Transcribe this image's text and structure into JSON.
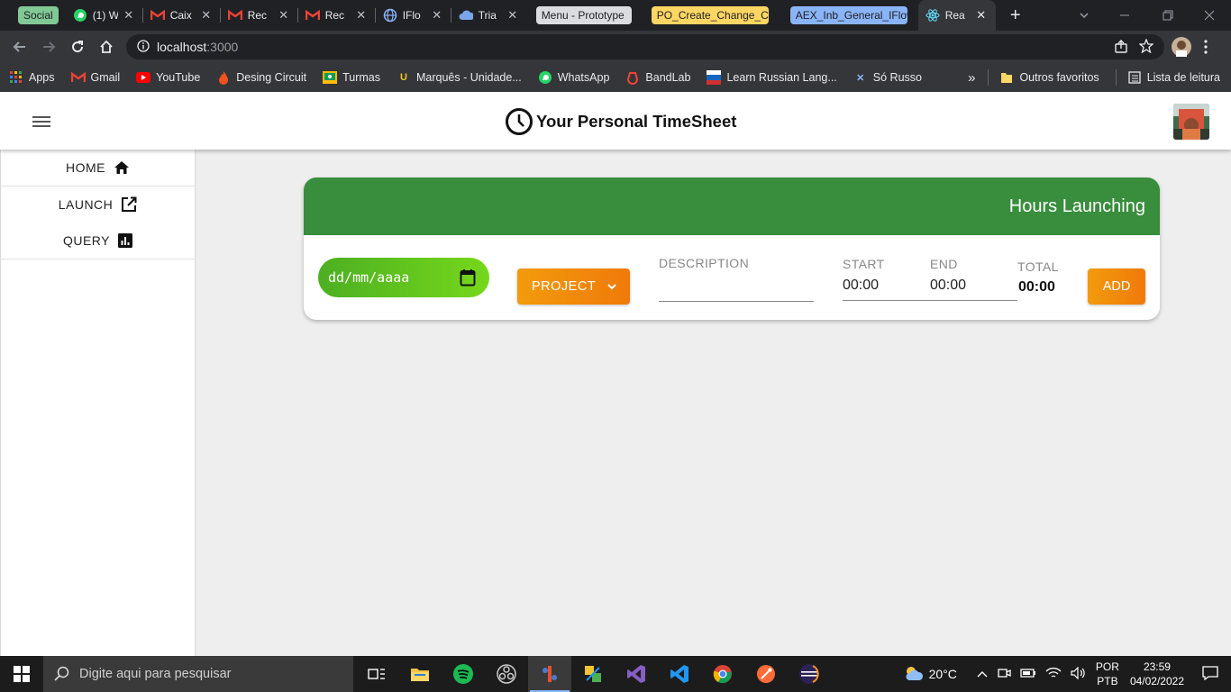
{
  "browser": {
    "tabs": [
      {
        "type": "group",
        "label": "Social",
        "color": "#81c995"
      },
      {
        "type": "tab",
        "title": "(1) W",
        "icon": "whatsapp-icon"
      },
      {
        "type": "tab",
        "title": "Caix",
        "icon": "gmail-icon"
      },
      {
        "type": "tab",
        "title": "Rec",
        "icon": "gmail-icon"
      },
      {
        "type": "tab",
        "title": "Rec",
        "icon": "gmail-icon"
      },
      {
        "type": "tab",
        "title": "IFlo",
        "icon": "globe-icon"
      },
      {
        "type": "tab",
        "title": "Tria",
        "icon": "cloud-icon"
      },
      {
        "type": "group",
        "label": "Menu - Prototype",
        "color": "#dadce0"
      },
      {
        "type": "group",
        "label": "PO_Create_Change_Ca",
        "color": "#fdd663"
      },
      {
        "type": "group",
        "label": "AEX_Inb_General_IFlow",
        "color": "#8ab4f8"
      },
      {
        "type": "tab",
        "title": "Rea",
        "icon": "react-icon",
        "active": true
      }
    ],
    "url_host": "localhost",
    "url_port": ":3000",
    "bookmarks": [
      {
        "label": "Apps",
        "icon": "apps-grid-icon"
      },
      {
        "label": "Gmail",
        "icon": "gmail-icon"
      },
      {
        "label": "YouTube",
        "icon": "youtube-icon"
      },
      {
        "label": "Desing Circuit",
        "icon": "flame-icon"
      },
      {
        "label": "Turmas",
        "icon": "classroom-icon"
      },
      {
        "label": "Marquês - Unidade...",
        "icon": "marques-icon"
      },
      {
        "label": "WhatsApp",
        "icon": "whatsapp-icon"
      },
      {
        "label": "BandLab",
        "icon": "bandlab-icon"
      },
      {
        "label": "Learn Russian Lang...",
        "icon": "flag-icon"
      },
      {
        "label": "Só Russo",
        "icon": "sorusso-icon"
      }
    ],
    "bookmarks_more": "»",
    "other_bookmarks": "Outros favoritos",
    "reading_list": "Lista de leitura"
  },
  "app": {
    "title": "Your Personal TimeSheet",
    "nav": [
      {
        "label": "HOME",
        "icon": "home-icon"
      },
      {
        "label": "LAUNCH",
        "icon": "open-in-new-icon"
      },
      {
        "label": "QUERY",
        "icon": "bar-chart-icon"
      }
    ],
    "card": {
      "title": "Hours Launching",
      "date_placeholder": "dd/mm/aaaa",
      "project_label": "PROJECT",
      "description_label": "DESCRIPTION",
      "description_value": "",
      "start_label": "START",
      "start_value": "00:00",
      "end_label": "END",
      "end_value": "00:00",
      "total_label": "TOTAL",
      "total_value": "00:00",
      "add_label": "ADD"
    },
    "colors": {
      "header_green": "#388e3c",
      "accent_orange": "#f29b0c",
      "date_green": "#5cc51e"
    }
  },
  "taskbar": {
    "search_placeholder": "Digite aqui para pesquisar",
    "apps": [
      "task-view-icon",
      "file-explorer-icon",
      "spotify-icon",
      "obs-icon",
      "git-tool-icon",
      "sap-icon",
      "visual-studio-icon",
      "vscode-icon",
      "chrome-icon",
      "postman-icon",
      "eclipse-icon"
    ],
    "weather": "20°C",
    "lang_line1": "POR",
    "lang_line2": "PTB",
    "time": "23:59",
    "date": "04/02/2022"
  }
}
